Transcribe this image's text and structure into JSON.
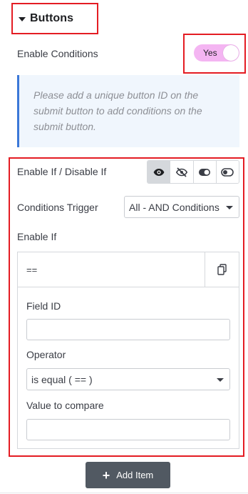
{
  "section": {
    "title": "Buttons"
  },
  "enable_conditions": {
    "label": "Enable Conditions",
    "toggle_text": "Yes",
    "toggle_on": true,
    "toggle_color": "#f4b5f2"
  },
  "notice": {
    "text": "Please add a unique button ID on the submit button to add conditions on the submit button.",
    "accent": "#3b78d8"
  },
  "enable_disable": {
    "label": "Enable If / Disable If",
    "options": [
      {
        "icon": "eye-icon",
        "selected": true
      },
      {
        "icon": "eye-slash-icon",
        "selected": false
      },
      {
        "icon": "toggle-on-icon",
        "selected": false
      },
      {
        "icon": "toggle-off-icon",
        "selected": false
      }
    ]
  },
  "conditions_trigger": {
    "label": "Conditions Trigger",
    "value": "All - AND Conditions"
  },
  "enable_if": {
    "label": "Enable If",
    "item": {
      "summary": "==",
      "field_id_label": "Field ID",
      "field_id_value": "",
      "operator_label": "Operator",
      "operator_value": "is equal ( == )",
      "compare_label": "Value to compare",
      "compare_value": ""
    }
  },
  "add_item": {
    "label": "Add Item"
  },
  "colors": {
    "highlight": "#e41c23",
    "button_bg": "#515962"
  }
}
